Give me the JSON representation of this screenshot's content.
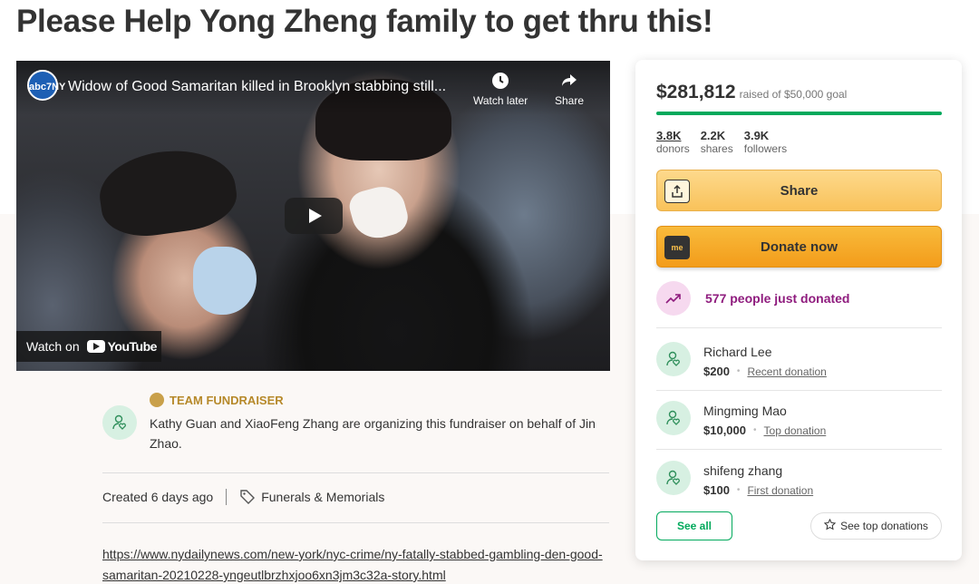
{
  "page_title": "Please Help Yong Zheng family to get thru this!",
  "video": {
    "channel_logo": "abc7NY",
    "title": "Widow of Good Samaritan killed in Brooklyn stabbing still...",
    "watch_later_label": "Watch later",
    "share_label": "Share",
    "watch_on_label": "Watch on",
    "youtube_label": "YouTube"
  },
  "organizer": {
    "team_label": "TEAM FUNDRAISER",
    "description": "Kathy Guan and XiaoFeng Zhang are organizing this fundraiser on behalf of Jin Zhao."
  },
  "meta": {
    "created": "Created 6 days ago",
    "category": "Funerals & Memorials"
  },
  "story": {
    "link": "https://www.nydailynews.com/new-york/nyc-crime/ny-fatally-stabbed-gambling-den-good-samaritan-20210228-yngeutlbrzhxjoo6xn3jm3c32a-story.html"
  },
  "sidebar": {
    "raised_amount": "$281,812",
    "goal_text": "raised of $50,000 goal",
    "progress_fraction": 1.0,
    "stats": [
      {
        "value": "3.8K",
        "label": "donors"
      },
      {
        "value": "2.2K",
        "label": "shares"
      },
      {
        "value": "3.9K",
        "label": "followers"
      }
    ],
    "share_button": "Share",
    "donate_button": "Donate now",
    "donate_icon_text": "me",
    "trending_text": "577 people just donated",
    "donations": [
      {
        "name": "Richard Lee",
        "amount": "$200",
        "kind": "Recent donation"
      },
      {
        "name": "Mingming Mao",
        "amount": "$10,000",
        "kind": "Top donation"
      },
      {
        "name": "shifeng zhang",
        "amount": "$100",
        "kind": "First donation"
      }
    ],
    "see_all_label": "See all",
    "see_top_label": "See top donations"
  },
  "colors": {
    "accent_green": "#02a95c",
    "team_gold": "#b6892a",
    "trend_purple": "#8f1c7e",
    "donate_orange": "#f39c1a"
  }
}
